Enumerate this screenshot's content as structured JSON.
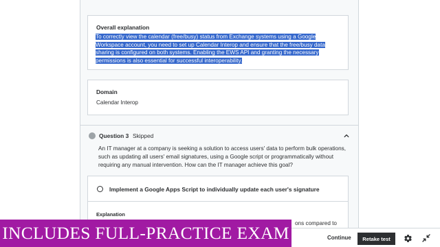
{
  "overall": {
    "title": "Overall explanation",
    "text": "To correctly view the calendar (free/busy) status from Exchange systems using a Google Workspace account, you need to set up Calendar Interop and ensure that the free/busy data sharing is configured on both systems. Enabling the EWS API and granting the necessary permissions is also essential for successful interoperability."
  },
  "domain": {
    "title": "Domain",
    "value": "Calendar Interop"
  },
  "question": {
    "number": "Question 3",
    "status": "Skipped",
    "text": "An IT manager at a company is seeking a solution to access users' data to perform bulk operations, such as updating all users' email signatures, using a Google script or programmatically without requiring any manual intervention. How can the IT manager achieve this goal?",
    "answer": "Implement a Google Apps Script to individually update each user's signature",
    "explanation_label": "Explanation",
    "explanation_tail": "ons compared to"
  },
  "banner": {
    "text": "INCLUDES FULL-PRACTICE EXAM"
  },
  "bottom_bar": {
    "continue_label": "Continue",
    "retake_label": "Retake test"
  },
  "icons": {
    "settings": "gear-icon",
    "collapse": "collapse-arrows-icon",
    "chevron": "chevron-up-icon"
  },
  "colors": {
    "highlight": "#3467cc",
    "banner": "#a11aa3",
    "primary_button": "#2d2f31",
    "skipped_dot": "#9da3a7"
  }
}
